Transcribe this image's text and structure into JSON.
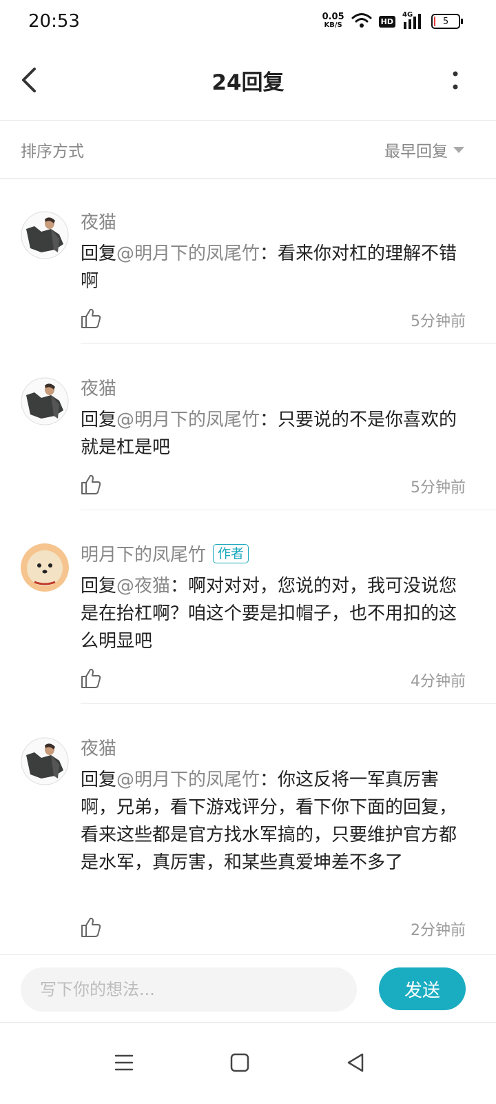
{
  "status_bar": {
    "time": "20:53",
    "net_speed_value": "0.05",
    "net_speed_unit": "KB/S",
    "hd_label": "HD",
    "network_type": "4G",
    "battery_level": "5",
    "battery_fraction": 0.05,
    "battery_color": "#e53935"
  },
  "header": {
    "title": "24回复",
    "back_icon": "chevron-left-icon",
    "more_icon": "more-vertical-icon"
  },
  "sort": {
    "label": "排序方式",
    "selected": "最早回复"
  },
  "replies": [
    {
      "user": "夜猫",
      "is_author": false,
      "prefix": "回复",
      "mention": "@明月下的凤尾竹",
      "text": "：看来你对杠的理解不错啊",
      "time": "5分钟前"
    },
    {
      "user": "夜猫",
      "is_author": false,
      "prefix": "回复",
      "mention": "@明月下的凤尾竹",
      "text": "：只要说的不是你喜欢的就是杠是吧",
      "time": "5分钟前"
    },
    {
      "user": "明月下的凤尾竹",
      "is_author": true,
      "author_tag": "作者",
      "prefix": "回复",
      "mention": "@夜猫",
      "text": "：啊对对对，您说的对，我可没说您是在抬杠啊？咱这个要是扣帽子，也不用扣的这么明显吧",
      "time": "4分钟前"
    },
    {
      "user": "夜猫",
      "is_author": false,
      "prefix": "回复",
      "mention": "@明月下的凤尾竹",
      "text": "：你这反将一军真厉害啊，兄弟，看下游戏评分，看下你下面的回复，看来这些都是官方找水军搞的，只要维护官方都是水军，真厉害，和某些真爱坤差不多了",
      "time": "2分钟前"
    }
  ],
  "compose": {
    "placeholder": "写下你的想法...",
    "send_label": "发送",
    "accent_color": "#1aadc2"
  },
  "nav": {
    "menu_icon": "menu-icon",
    "home_icon": "home-square-icon",
    "back_icon": "back-triangle-icon"
  }
}
